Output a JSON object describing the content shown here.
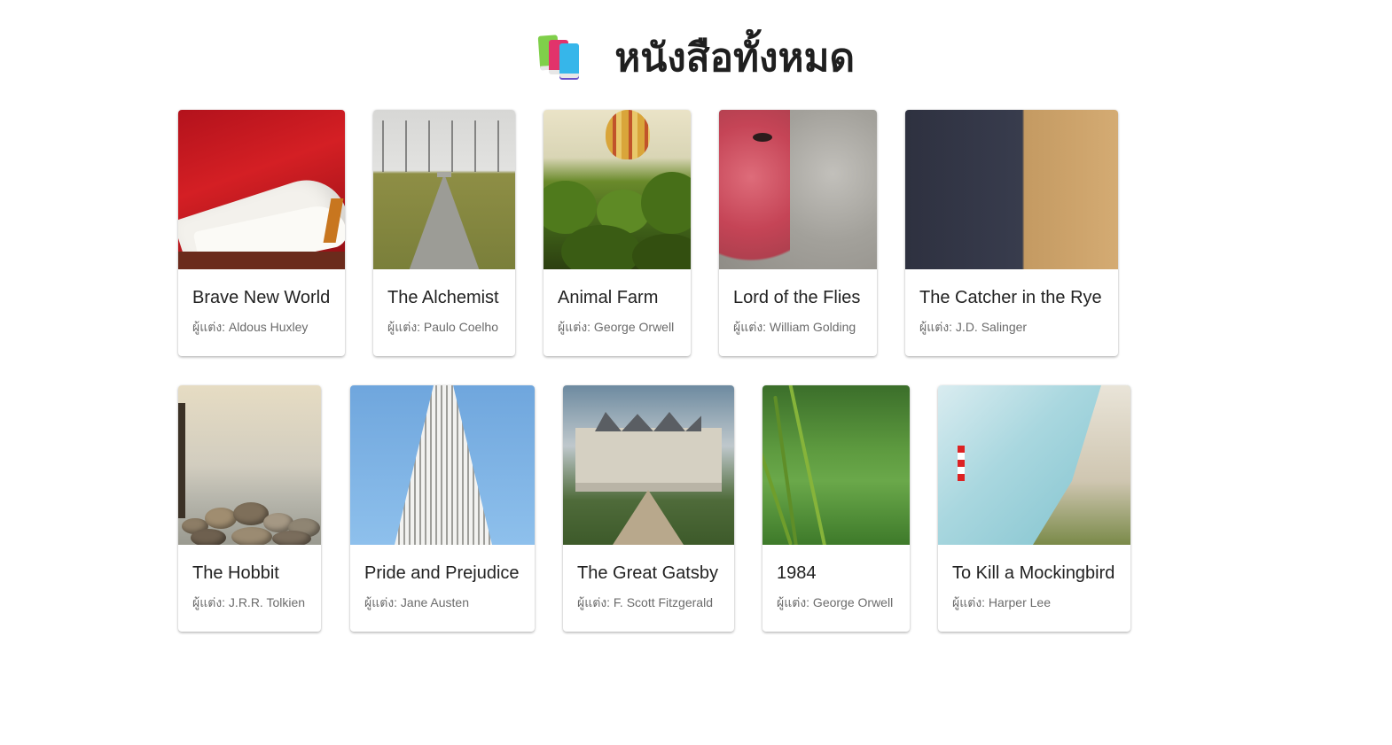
{
  "page": {
    "heading": "หนังสือทั้งหมด",
    "heading_icon": "books-icon",
    "author_prefix": "ผู้แต่ง: "
  },
  "books": [
    {
      "title": "Brave New World",
      "author": "ผู้แต่ง: Aldous Huxley",
      "image_icon": "shoe-image"
    },
    {
      "title": "The Alchemist",
      "author": "ผู้แต่ง: Paulo Coelho",
      "image_icon": "road-trees-image"
    },
    {
      "title": "Animal Farm",
      "author": "ผู้แต่ง: George Orwell",
      "image_icon": "balloon-palms-image"
    },
    {
      "title": "Lord of the Flies",
      "author": "ผู้แต่ง: William Golding",
      "image_icon": "monkey-face-image"
    },
    {
      "title": "The Catcher in the Rye",
      "author": "ผู้แต่ง: J.D. Salinger",
      "image_icon": "sand-dune-image"
    },
    {
      "title": "The Hobbit",
      "author": "ผู้แต่ง: J.R.R. Tolkien",
      "image_icon": "stones-lake-image"
    },
    {
      "title": "Pride and Prejudice",
      "author": "ผู้แต่ง: Jane Austen",
      "image_icon": "tower-image"
    },
    {
      "title": "The Great Gatsby",
      "author": "ผู้แต่ง: F. Scott Fitzgerald",
      "image_icon": "castle-image"
    },
    {
      "title": "1984",
      "author": "ผู้แต่ง: George Orwell",
      "image_icon": "grass-image"
    },
    {
      "title": "To Kill a Mockingbird",
      "author": "ผู้แต่ง: Harper Lee",
      "image_icon": "lighthouse-cliff-image"
    }
  ]
}
